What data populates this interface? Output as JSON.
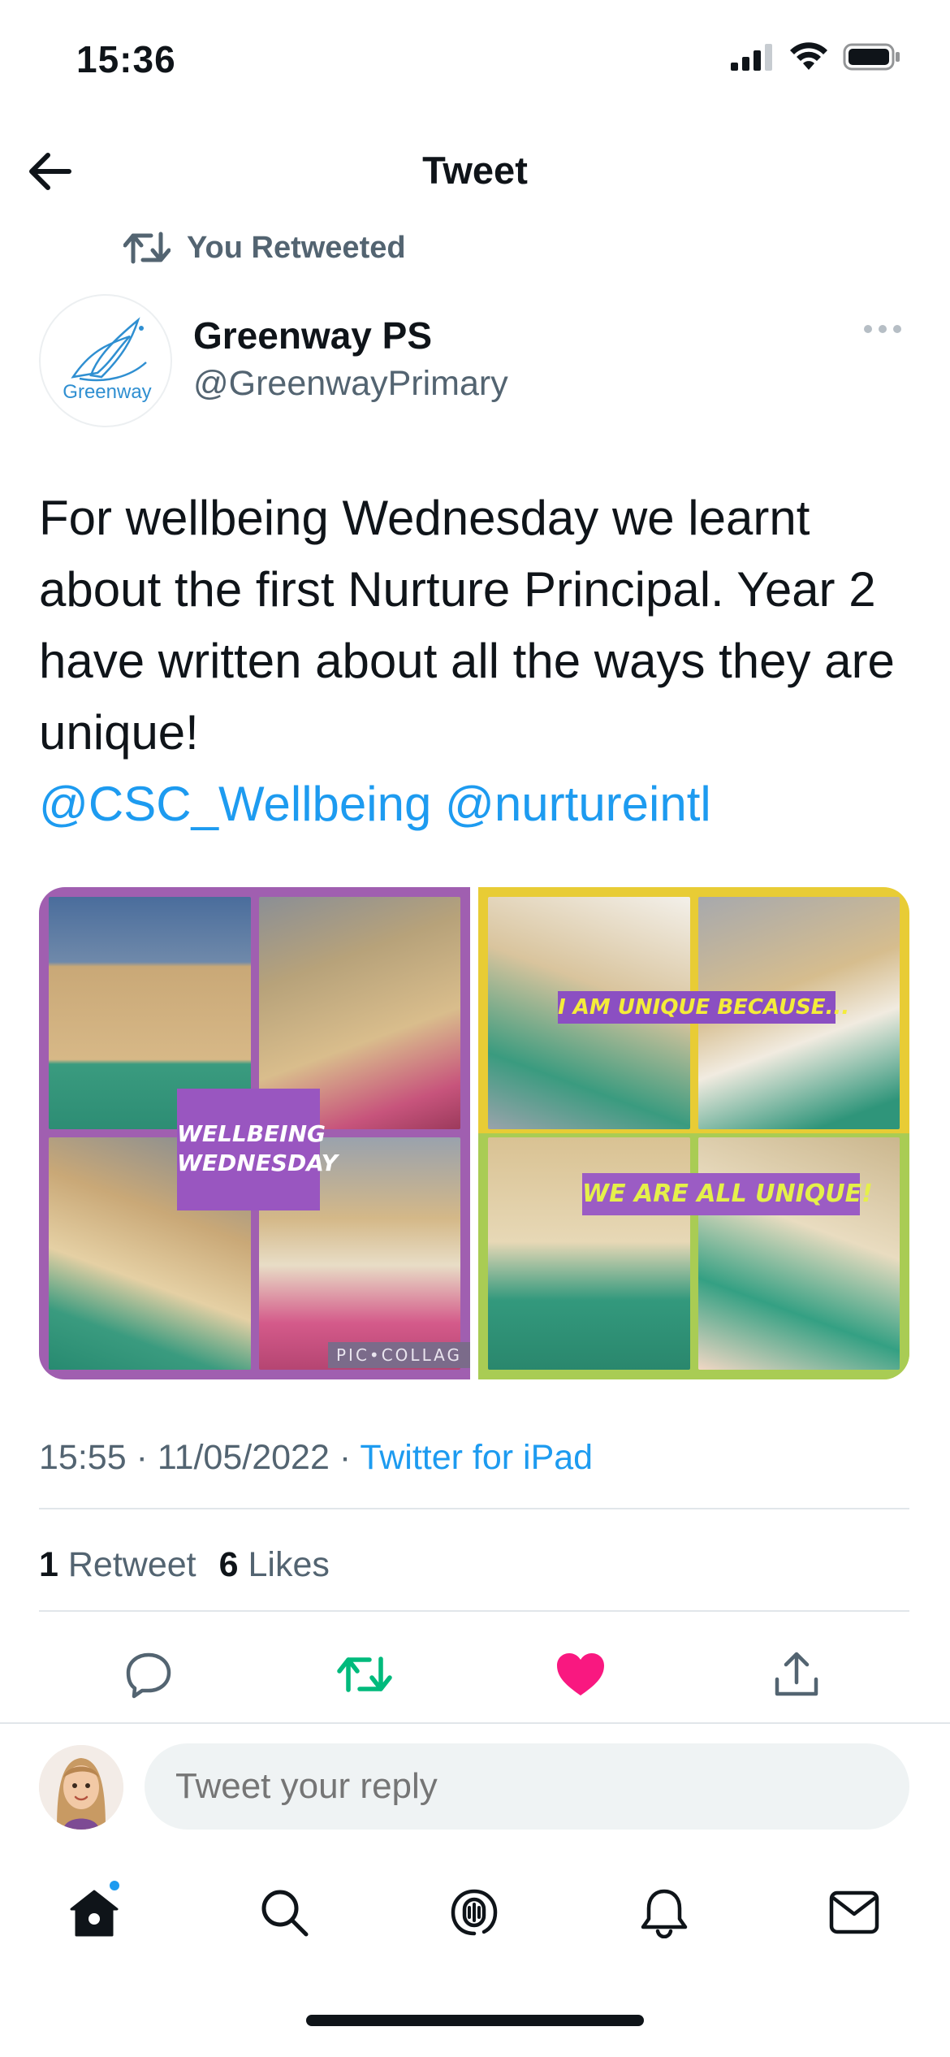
{
  "status_bar": {
    "time": "15:36"
  },
  "nav": {
    "title": "Tweet"
  },
  "retweet": {
    "label": "You Retweeted"
  },
  "author": {
    "name": "Greenway PS",
    "handle": "@GreenwayPrimary",
    "avatar_text": "Greenway"
  },
  "tweet": {
    "text": "For wellbeing Wednesday we learnt about the first Nurture Principal. Year 2 have written about all the ways they are unique!",
    "mentions": [
      "@CSC_Wellbeing",
      "@nurtureintl"
    ]
  },
  "media": {
    "left_banner": "WELLBEING WEDNESDAY",
    "right_banner_top": "I AM UNIQUE BECAUSE...",
    "right_banner_bottom": "WE ARE ALL UNIQUE!",
    "watermark": "PIC•COLLAG"
  },
  "meta": {
    "time": "15:55",
    "date": "11/05/2022",
    "separator": "·",
    "source": "Twitter for iPad"
  },
  "counts": {
    "retweets_value": "1",
    "retweets_label": "Retweet",
    "likes_value": "6",
    "likes_label": "Likes"
  },
  "reply": {
    "placeholder": "Tweet your reply"
  },
  "colors": {
    "accent": "#1d9bf0",
    "retweet_active": "#00ba7c",
    "like_active": "#f91880",
    "secondary_text": "#536471"
  },
  "icons": {
    "back": "arrow-left-icon",
    "retweet": "retweet-icon",
    "more": "ellipsis-icon",
    "reply": "comment-icon",
    "like": "heart-icon",
    "share": "share-icon",
    "home": "home-icon",
    "search": "search-icon",
    "spaces": "spaces-icon",
    "notifications": "bell-icon",
    "messages": "mail-icon"
  }
}
